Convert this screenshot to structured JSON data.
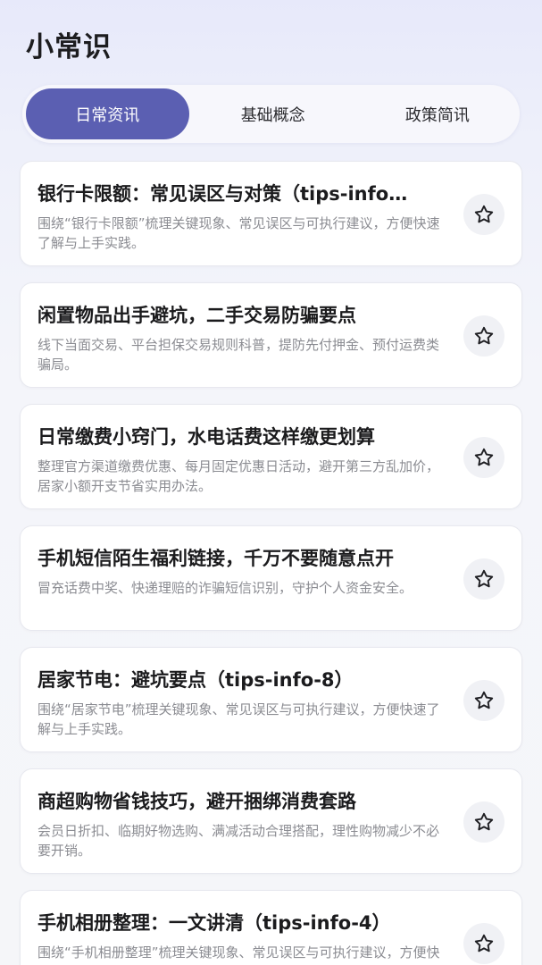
{
  "header": {
    "title": "小常识"
  },
  "tabs": [
    {
      "label": "日常资讯",
      "active": true
    },
    {
      "label": "基础概念",
      "active": false
    },
    {
      "label": "政策简讯",
      "active": false
    }
  ],
  "colors": {
    "accent": "#5b5fb2",
    "card_bg": "#ffffff",
    "page_bg": "#eef0fa"
  },
  "articles": [
    {
      "title": "银行卡限额：常见误区与对策（tips-info…",
      "desc": "围绕“银行卡限额”梳理关键现象、常见误区与可执行建议，方便快速了解与上手实践。",
      "icon": "star-outline-icon"
    },
    {
      "title": "闲置物品出手避坑，二手交易防骗要点",
      "desc": "线下当面交易、平台担保交易规则科普，提防先付押金、预付运费类骗局。",
      "icon": "star-outline-icon"
    },
    {
      "title": "日常缴费小窍门，水电话费这样缴更划算",
      "desc": "整理官方渠道缴费优惠、每月固定优惠日活动，避开第三方乱加价，居家小额开支节省实用办法。",
      "icon": "star-outline-icon"
    },
    {
      "title": "手机短信陌生福利链接，千万不要随意点开",
      "desc": "冒充话费中奖、快递理赔的诈骗短信识别，守护个人资金安全。",
      "icon": "star-outline-icon"
    },
    {
      "title": "居家节电：避坑要点（tips-info-8）",
      "desc": "围绕“居家节电”梳理关键现象、常见误区与可执行建议，方便快速了解与上手实践。",
      "icon": "star-outline-icon"
    },
    {
      "title": "商超购物省钱技巧，避开捆绑消费套路",
      "desc": "会员日折扣、临期好物选购、满减活动合理搭配，理性购物减少不必要开销。",
      "icon": "star-outline-icon"
    },
    {
      "title": "手机相册整理：一文讲清（tips-info-4）",
      "desc": "围绕“手机相册整理”梳理关键现象、常见误区与可执行建议，方便快速了解与上手实践。",
      "icon": "star-outline-icon"
    }
  ]
}
